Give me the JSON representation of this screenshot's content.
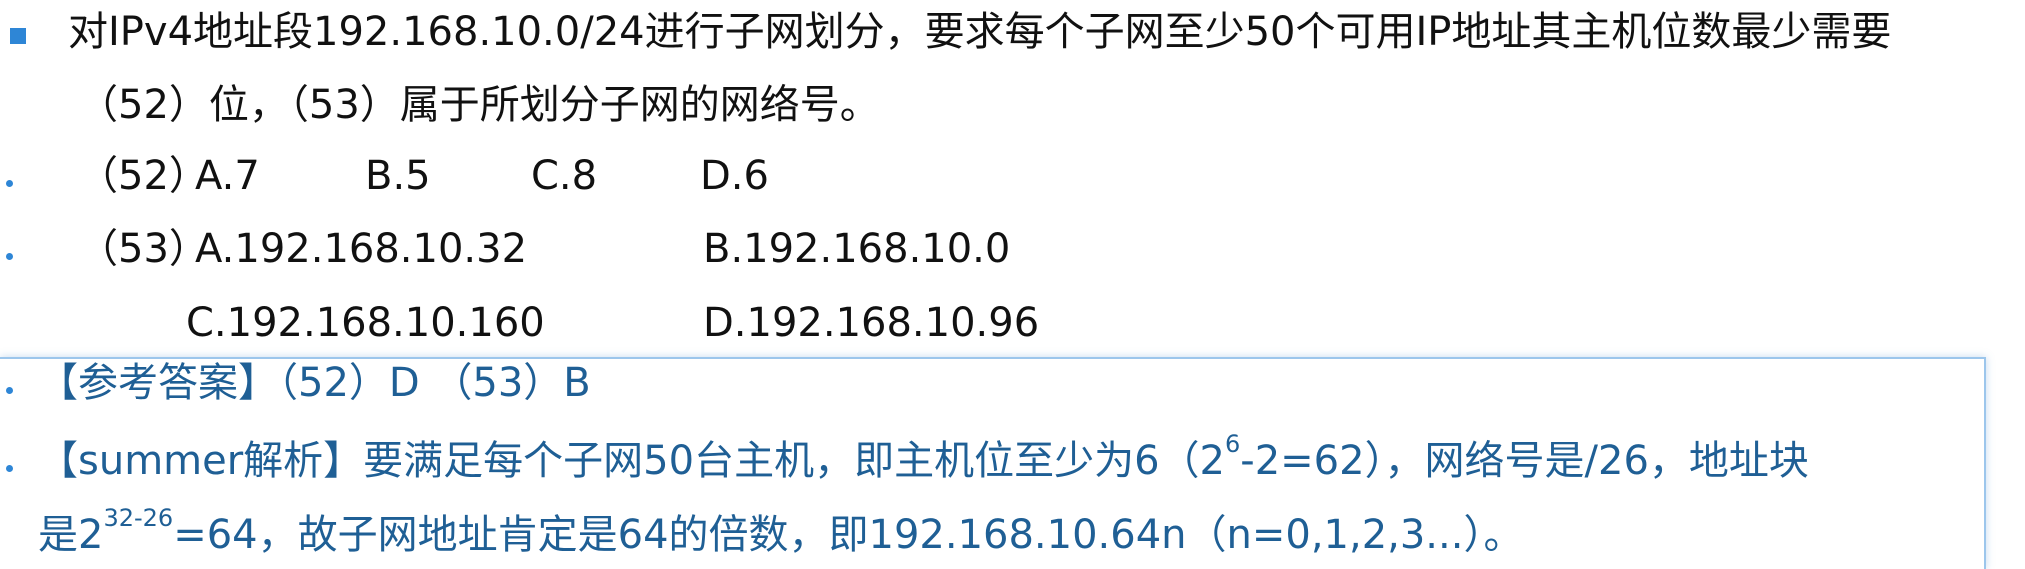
{
  "question": {
    "line1": "对IPv4地址段192.168.10.0/24进行子网划分，要求每个子网至少50个可用IP地址其主机位数最少需要",
    "line2": "（52）位，（53）属于所划分子网的网络号。"
  },
  "options": {
    "q52": {
      "label": "（52）",
      "items": [
        "A.7",
        "B.5",
        "C.8",
        "D.6"
      ]
    },
    "q53": {
      "label": "（53）",
      "items": [
        "A.192.168.10.32",
        "B.192.168.10.0",
        "C.192.168.10.160",
        "D.192.168.10.96"
      ]
    }
  },
  "answer": {
    "text": "【参考答案】（52）D （53）B"
  },
  "analysis": {
    "line1_prefix": "【summer解析】要满足每个子网50台主机，即主机位至少为6（2",
    "line1_sup": "6",
    "line1_suffix": "-2=62），网络号是/26，地址块",
    "line2_prefix": "是2",
    "line2_sup": "32-26",
    "line2_suffix": "=64，故子网地址肯定是64的倍数，即192.168.10.64n（n=0,1,2,3...）。"
  },
  "colors": {
    "marker": "#2e86d6",
    "analysis_text": "#1f5f95",
    "box_border": "#9cc6ec"
  }
}
